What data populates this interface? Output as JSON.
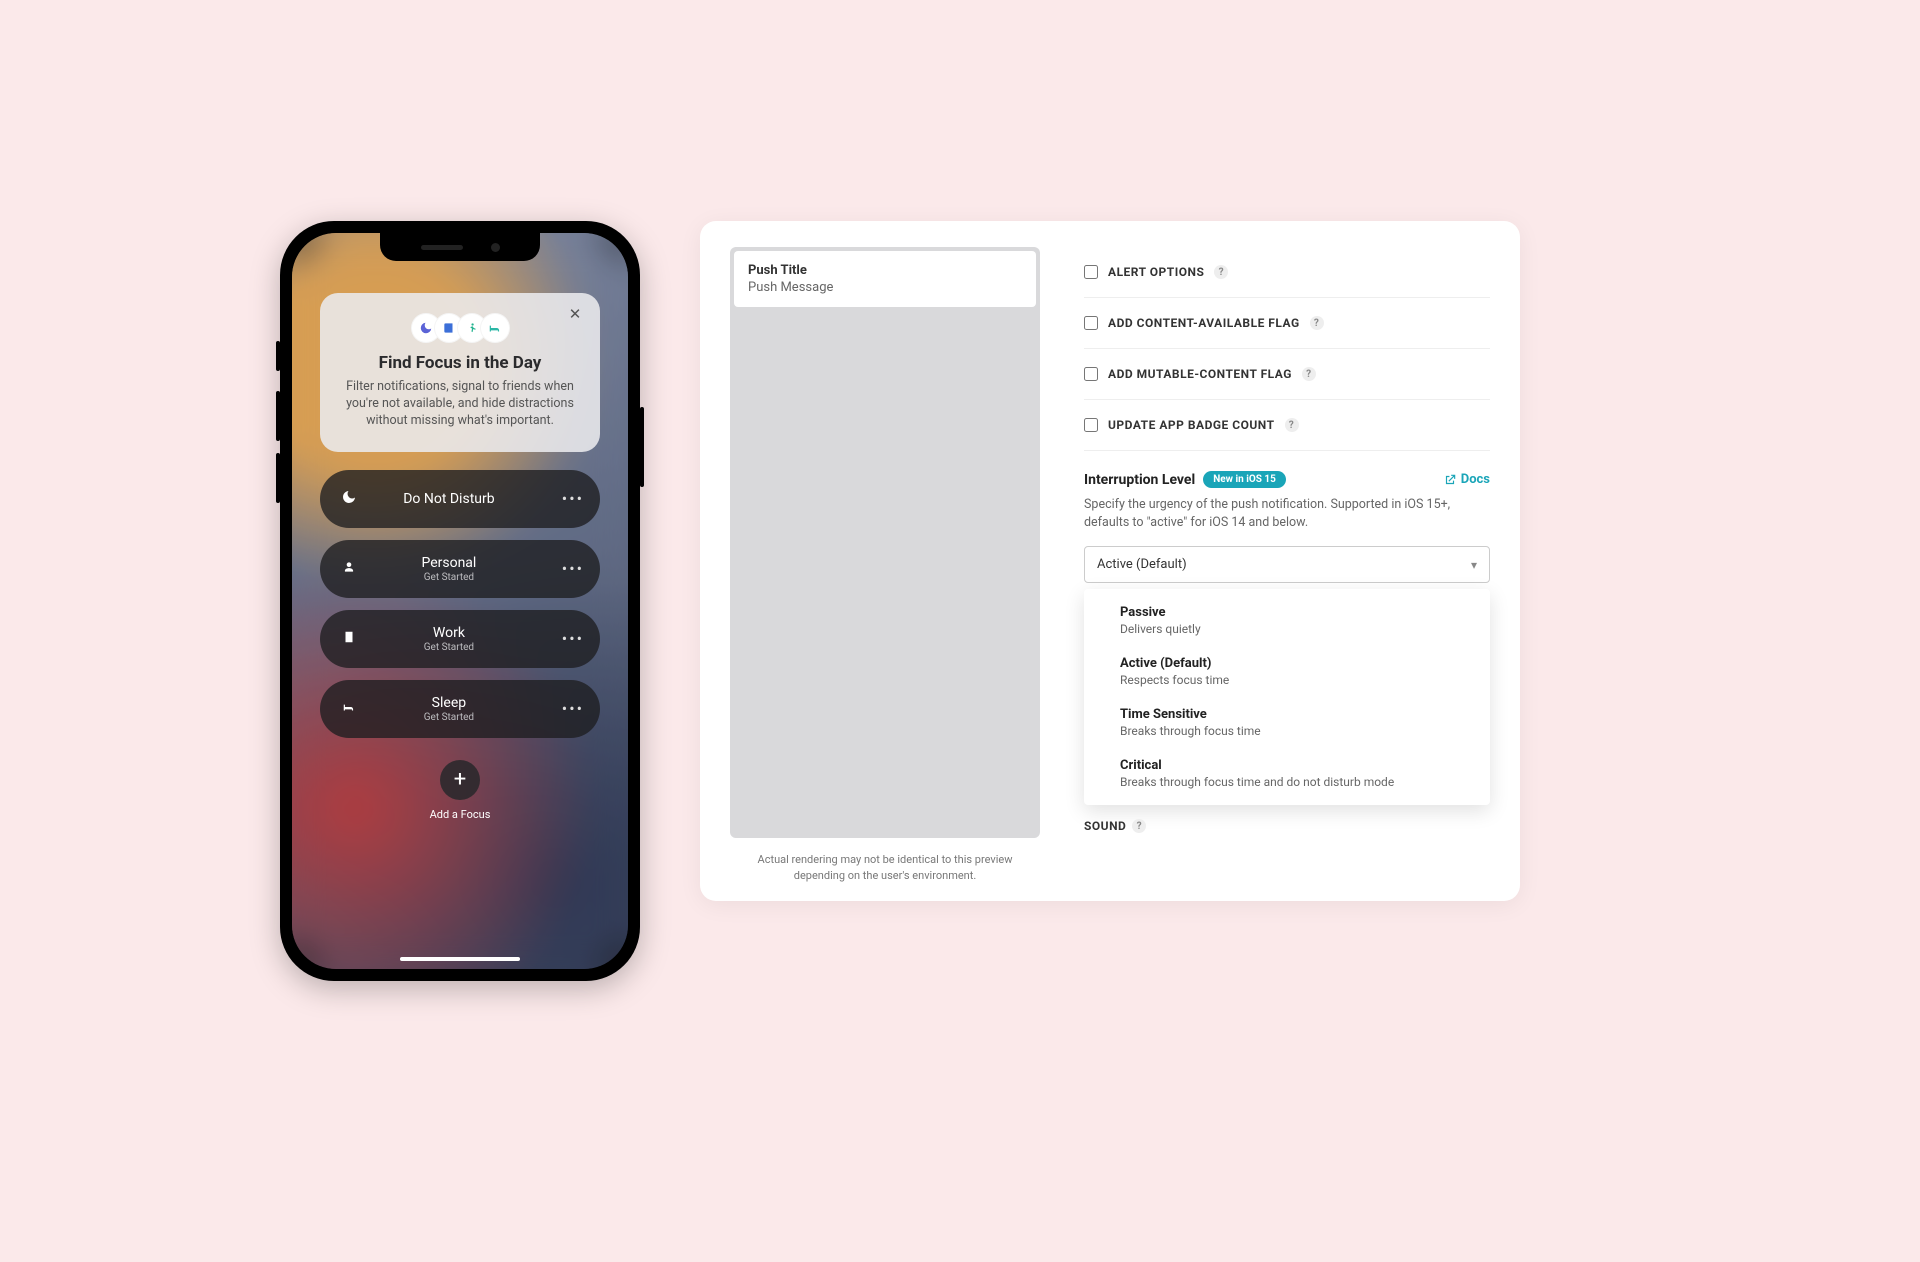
{
  "phone": {
    "card": {
      "title": "Find Focus in the Day",
      "desc": "Filter notifications, signal to friends when you're not available, and hide distractions without missing what's important.",
      "icons": [
        "moon-icon",
        "book-icon",
        "run-icon",
        "bed-icon"
      ]
    },
    "modes": [
      {
        "icon": "moon-icon",
        "title": "Do Not Disturb",
        "sub": ""
      },
      {
        "icon": "person-icon",
        "title": "Personal",
        "sub": "Get Started"
      },
      {
        "icon": "badge-icon",
        "title": "Work",
        "sub": "Get Started"
      },
      {
        "icon": "bed-icon",
        "title": "Sleep",
        "sub": "Get Started"
      }
    ],
    "add_label": "Add a Focus"
  },
  "panel": {
    "preview": {
      "push_title": "Push Title",
      "push_message": "Push Message",
      "note": "Actual rendering may not be identical to this preview depending on the user's environment."
    },
    "options": [
      "ALERT OPTIONS",
      "ADD CONTENT-AVAILABLE FLAG",
      "ADD MUTABLE-CONTENT FLAG",
      "UPDATE APP BADGE COUNT"
    ],
    "interruption": {
      "title": "Interruption Level",
      "badge": "New in iOS 15",
      "docs": "Docs",
      "desc": "Specify the urgency of the push notification. Supported in iOS 15+, defaults to \"active\" for iOS 14 and below.",
      "selected": "Active (Default)",
      "levels": [
        {
          "title": "Passive",
          "desc": "Delivers quietly"
        },
        {
          "title": "Active (Default)",
          "desc": "Respects focus time"
        },
        {
          "title": "Time Sensitive",
          "desc": "Breaks through focus time"
        },
        {
          "title": "Critical",
          "desc": "Breaks through focus time and do not disturb mode"
        }
      ]
    },
    "sound_label": "SOUND"
  },
  "colors": {
    "accent": "#1aa5b8",
    "bg": "#fbe9ea",
    "moon": "#5b63d6",
    "book": "#3c6fd8",
    "run": "#23b38f",
    "bed": "#2bb7a6"
  }
}
